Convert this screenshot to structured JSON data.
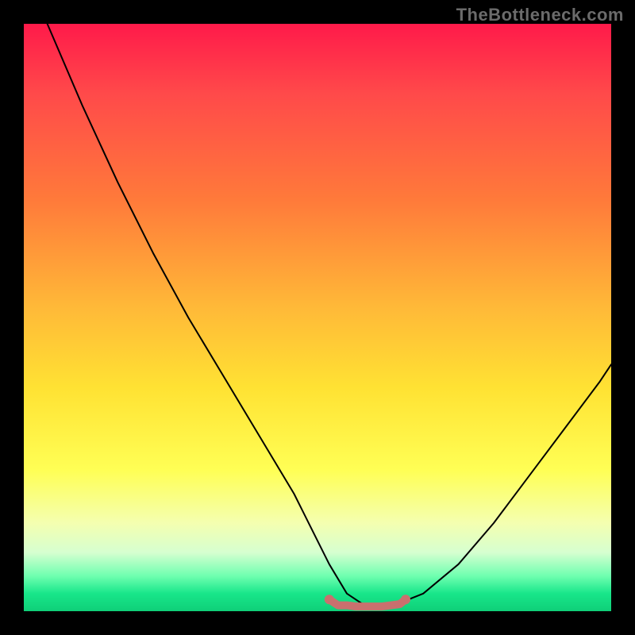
{
  "watermark": "TheBottleneck.com",
  "background_color": "#000000",
  "gradient_stops": [
    {
      "pct": 0,
      "color": "#ff1a4a"
    },
    {
      "pct": 12,
      "color": "#ff4a4a"
    },
    {
      "pct": 30,
      "color": "#ff7a3a"
    },
    {
      "pct": 48,
      "color": "#ffb838"
    },
    {
      "pct": 62,
      "color": "#ffe233"
    },
    {
      "pct": 76,
      "color": "#ffff55"
    },
    {
      "pct": 85,
      "color": "#f4ffb0"
    },
    {
      "pct": 90,
      "color": "#d6ffd0"
    },
    {
      "pct": 94,
      "color": "#6fffb0"
    },
    {
      "pct": 97,
      "color": "#18e68a"
    },
    {
      "pct": 100,
      "color": "#0fcf78"
    }
  ],
  "chart_data": {
    "type": "line",
    "title": "",
    "xlabel": "",
    "ylabel": "",
    "xlim": [
      0,
      100
    ],
    "ylim": [
      0,
      100
    ],
    "legend": [],
    "annotations": [],
    "series": [
      {
        "name": "bottleneck-curve",
        "stroke": "#000000",
        "stroke_width": 2,
        "x": [
          4,
          10,
          16,
          22,
          28,
          34,
          40,
          46,
          49,
          52,
          55,
          58,
          60,
          63,
          68,
          74,
          80,
          86,
          92,
          98,
          100
        ],
        "y": [
          100,
          86,
          73,
          61,
          50,
          40,
          30,
          20,
          14,
          8,
          3,
          1,
          1,
          1,
          3,
          8,
          15,
          23,
          31,
          39,
          42
        ]
      },
      {
        "name": "flat-bottom-marker",
        "stroke": "#c9706e",
        "stroke_width": 10,
        "x": [
          52,
          53.5,
          55,
          56.5,
          58,
          59.5,
          61,
          62.5,
          64,
          65
        ],
        "y": [
          2,
          1,
          1,
          0.8,
          0.8,
          0.8,
          0.8,
          1,
          1.2,
          2
        ]
      }
    ],
    "markers": [
      {
        "name": "flat-left-dot",
        "x": 52,
        "y": 2,
        "r": 6,
        "color": "#c9706e"
      },
      {
        "name": "flat-right-dot",
        "x": 65,
        "y": 2,
        "r": 6,
        "color": "#c9706e"
      }
    ]
  }
}
